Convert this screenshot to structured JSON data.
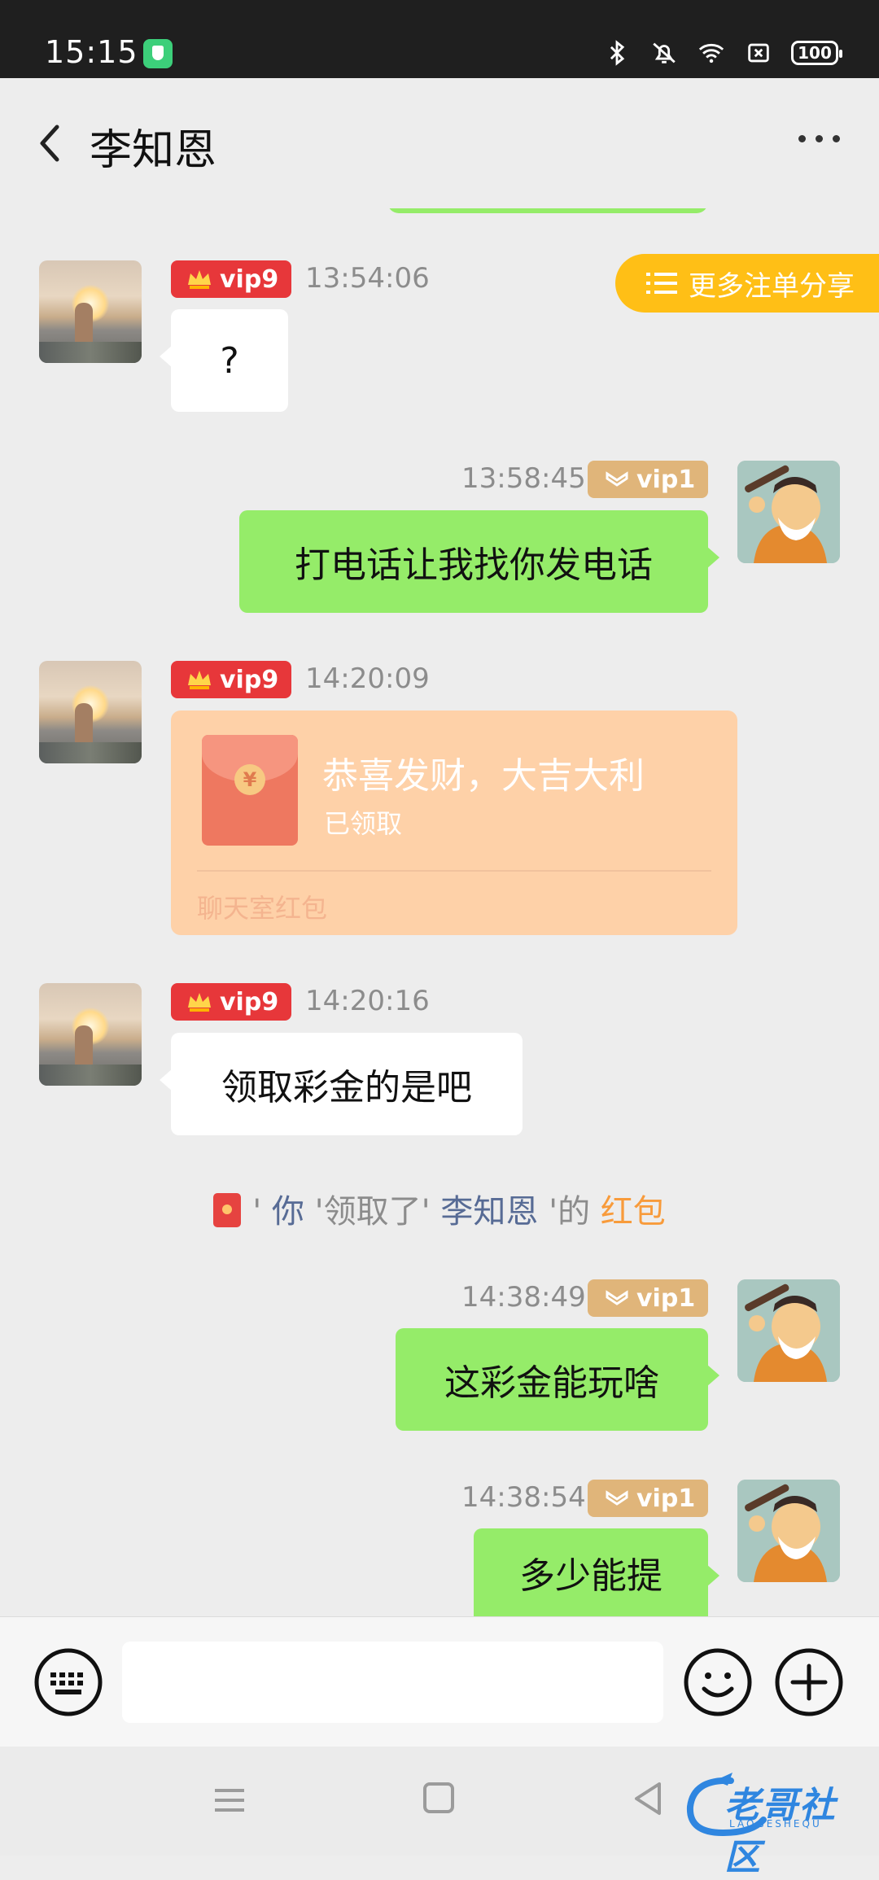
{
  "status_bar": {
    "time": "15:15",
    "battery": "100"
  },
  "header": {
    "title": "李知恩"
  },
  "float_button": {
    "label": "更多注单分享"
  },
  "messages": [
    {
      "vip": "vip9",
      "time": "13:54:06",
      "text": "?"
    },
    {
      "vip": "vip1",
      "time": "13:58:45",
      "text": "打电话让我找你发电话"
    },
    {
      "vip": "vip9",
      "time": "14:20:09",
      "red_packet": {
        "title": "恭喜发财，大吉大利",
        "status": "已领取",
        "footer": "聊天室红包"
      }
    },
    {
      "vip": "vip9",
      "time": "14:20:16",
      "text": "领取彩金的是吧"
    },
    {
      "vip": "vip1",
      "time": "14:38:49",
      "text": "这彩金能玩啥"
    },
    {
      "vip": "vip1",
      "time": "14:38:54",
      "text": "多少能提"
    }
  ],
  "notice": {
    "q1": "'",
    "you": "你",
    "middle": "'领取了'",
    "name": "李知恩",
    "suffix": "'的",
    "packet": "红包"
  },
  "input": {
    "placeholder": ""
  },
  "watermark": {
    "text": "老哥社区",
    "sub": "LAOGESHEQU"
  }
}
